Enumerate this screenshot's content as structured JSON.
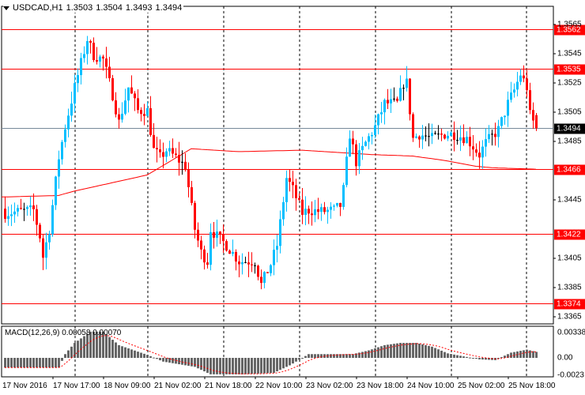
{
  "header": {
    "symbol": "USDCAD,H1",
    "open": "1.3503",
    "high": "1.3504",
    "low": "1.3493",
    "close": "1.3494"
  },
  "macd": {
    "label": "MACD(12,26,9)",
    "main": "0.00058",
    "signal": "0.00070",
    "axis": [
      "0.00338",
      "0.00",
      "-0.0023"
    ]
  },
  "colors": {
    "bull": "#00bfff",
    "bear": "#ff0000",
    "doji": "#000000",
    "level": "#ff0000",
    "current": "#778899",
    "ma": "#ff0000",
    "hist": "#666666"
  },
  "price_axis": [
    "1.3565",
    "1.3545",
    "1.3525",
    "1.3505",
    "1.3485",
    "1.3445",
    "1.3405",
    "1.3385",
    "1.3365"
  ],
  "levels": [
    "1.3562",
    "1.3535",
    "1.3466",
    "1.3422",
    "1.3374"
  ],
  "current_price": "1.3494",
  "time_axis": [
    "17 Nov 2016",
    "17 Nov 17:00",
    "18 Nov 09:00",
    "21 Nov 02:00",
    "21 Nov 18:00",
    "22 Nov 10:00",
    "23 Nov 02:00",
    "23 Nov 18:00",
    "24 Nov 10:00",
    "25 Nov 02:00",
    "25 Nov 18:00"
  ],
  "chart_data": {
    "type": "candlestick",
    "bars": 169,
    "close_waypoints": [
      [
        0,
        1.3436
      ],
      [
        9,
        1.3438
      ],
      [
        11,
        1.342
      ],
      [
        12,
        1.3406
      ],
      [
        14,
        1.3425
      ],
      [
        17,
        1.3474
      ],
      [
        19,
        1.3495
      ],
      [
        22,
        1.3522
      ],
      [
        26,
        1.3555
      ],
      [
        28,
        1.3544
      ],
      [
        31,
        1.3541
      ],
      [
        34,
        1.3517
      ],
      [
        36,
        1.3498
      ],
      [
        39,
        1.3522
      ],
      [
        42,
        1.3506
      ],
      [
        45,
        1.3506
      ],
      [
        47,
        1.3479
      ],
      [
        49,
        1.3474
      ],
      [
        51,
        1.3479
      ],
      [
        54,
        1.3474
      ],
      [
        57,
        1.3468
      ],
      [
        60,
        1.3425
      ],
      [
        62,
        1.3409
      ],
      [
        64,
        1.3403
      ],
      [
        65,
        1.3425
      ],
      [
        67,
        1.342
      ],
      [
        70,
        1.3414
      ],
      [
        74,
        1.3403
      ],
      [
        76,
        1.3403
      ],
      [
        79,
        1.3403
      ],
      [
        81,
        1.3387
      ],
      [
        84,
        1.3401
      ],
      [
        86,
        1.3414
      ],
      [
        89,
        1.346
      ],
      [
        91,
        1.3452
      ],
      [
        94,
        1.3436
      ],
      [
        96,
        1.3438
      ],
      [
        100,
        1.3437
      ],
      [
        104,
        1.3438
      ],
      [
        106,
        1.3441
      ],
      [
        107,
        1.3452
      ],
      [
        109,
        1.349
      ],
      [
        111,
        1.3471
      ],
      [
        114,
        1.3484
      ],
      [
        117,
        1.3495
      ],
      [
        120,
        1.3511
      ],
      [
        124,
        1.3511
      ],
      [
        126,
        1.3525
      ],
      [
        127,
        1.3525
      ],
      [
        129,
        1.3487
      ],
      [
        131,
        1.349
      ],
      [
        135,
        1.3487
      ],
      [
        139,
        1.349
      ],
      [
        142,
        1.349
      ],
      [
        146,
        1.3487
      ],
      [
        150,
        1.3476
      ],
      [
        152,
        1.3484
      ],
      [
        156,
        1.3493
      ],
      [
        159,
        1.3511
      ],
      [
        161,
        1.352
      ],
      [
        163,
        1.3531
      ],
      [
        165,
        1.3522
      ],
      [
        166,
        1.3503
      ],
      [
        168,
        1.3494
      ]
    ],
    "ma_waypoints": [
      [
        0,
        1.3447
      ],
      [
        17,
        1.3448
      ],
      [
        22,
        1.3451
      ],
      [
        45,
        1.3462
      ],
      [
        59,
        1.348
      ],
      [
        74,
        1.3478
      ],
      [
        94,
        1.3479
      ],
      [
        116,
        1.3476
      ],
      [
        129,
        1.3475
      ],
      [
        139,
        1.3472
      ],
      [
        149,
        1.3468
      ],
      [
        154,
        1.3467
      ],
      [
        168,
        1.3466
      ]
    ],
    "macd_waypoints": [
      [
        0,
        -0.0013
      ],
      [
        17,
        -0.0013
      ],
      [
        19,
        0.0005
      ],
      [
        22,
        0.002
      ],
      [
        27,
        0.0035
      ],
      [
        31,
        0.0035
      ],
      [
        36,
        0.0017
      ],
      [
        45,
        0.0004
      ],
      [
        50,
        -0.0005
      ],
      [
        60,
        -0.0012
      ],
      [
        65,
        -0.0022
      ],
      [
        75,
        -0.0022
      ],
      [
        85,
        -0.002
      ],
      [
        90,
        -0.001
      ],
      [
        94,
        0.0
      ],
      [
        96,
        0.0005
      ],
      [
        110,
        0.0005
      ],
      [
        115,
        0.001
      ],
      [
        120,
        0.0017
      ],
      [
        125,
        0.002
      ],
      [
        130,
        0.002
      ],
      [
        135,
        0.0015
      ],
      [
        140,
        0.0006
      ],
      [
        145,
        0.0002
      ],
      [
        150,
        -0.0002
      ],
      [
        155,
        -0.0003
      ],
      [
        160,
        0.0007
      ],
      [
        165,
        0.0011
      ],
      [
        168,
        0.0008
      ]
    ],
    "price_range": [
      1.3358,
      1.3572
    ],
    "macd_range": [
      -0.0026,
      0.0039
    ]
  }
}
